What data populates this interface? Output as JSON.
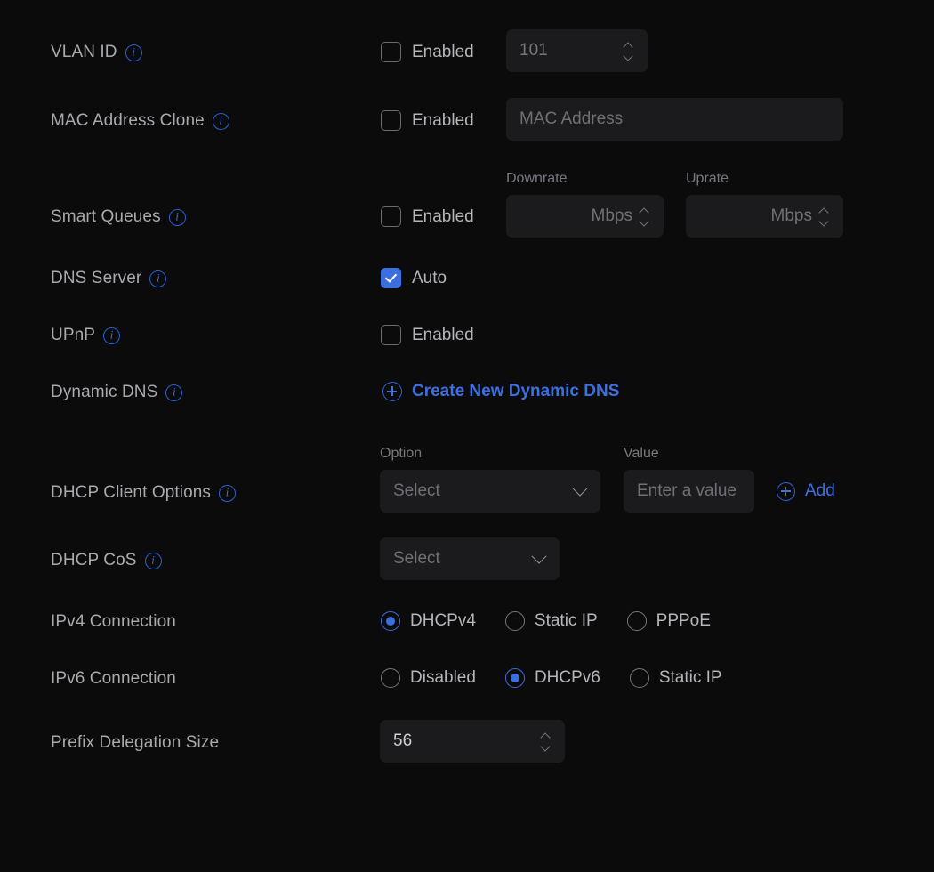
{
  "theme": {
    "background": "#0b0b0c",
    "field_background": "#1b1b1d",
    "accent": "#3b6fe0",
    "label_color": "#a9a9ae",
    "placeholder_color": "#6f6f76"
  },
  "rows": {
    "vlan_id": {
      "label": "VLAN ID",
      "info": "i",
      "checkbox_label": "Enabled",
      "checked": false,
      "value": "101"
    },
    "mac_address_clone": {
      "label": "MAC Address Clone",
      "info": "i",
      "checkbox_label": "Enabled",
      "checked": false,
      "placeholder": "MAC Address"
    },
    "smart_queues": {
      "label": "Smart Queues",
      "info": "i",
      "checkbox_label": "Enabled",
      "checked": false,
      "downrate_label": "Downrate",
      "downrate_placeholder": "Mbps",
      "uprate_label": "Uprate",
      "uprate_placeholder": "Mbps"
    },
    "dns_server": {
      "label": "DNS Server",
      "info": "i",
      "checkbox_label": "Auto",
      "checked": true
    },
    "upnp": {
      "label": "UPnP",
      "info": "i",
      "checkbox_label": "Enabled",
      "checked": false
    },
    "dynamic_dns": {
      "label": "Dynamic DNS",
      "info": "i",
      "create_link": "Create New Dynamic DNS"
    },
    "dhcp_client_options": {
      "label": "DHCP Client Options",
      "info": "i",
      "option_label": "Option",
      "option_value": "Select",
      "value_label": "Value",
      "value_placeholder": "Enter a value",
      "add_link": "Add"
    },
    "dhcp_cos": {
      "label": "DHCP CoS",
      "info": "i",
      "select_value": "Select"
    },
    "ipv4_connection": {
      "label": "IPv4 Connection",
      "options": [
        {
          "label": "DHCPv4",
          "selected": true
        },
        {
          "label": "Static IP",
          "selected": false
        },
        {
          "label": "PPPoE",
          "selected": false
        }
      ]
    },
    "ipv6_connection": {
      "label": "IPv6 Connection",
      "options": [
        {
          "label": "Disabled",
          "selected": false
        },
        {
          "label": "DHCPv6",
          "selected": true
        },
        {
          "label": "Static IP",
          "selected": false
        }
      ]
    },
    "prefix_delegation_size": {
      "label": "Prefix Delegation Size",
      "value": "56"
    }
  }
}
